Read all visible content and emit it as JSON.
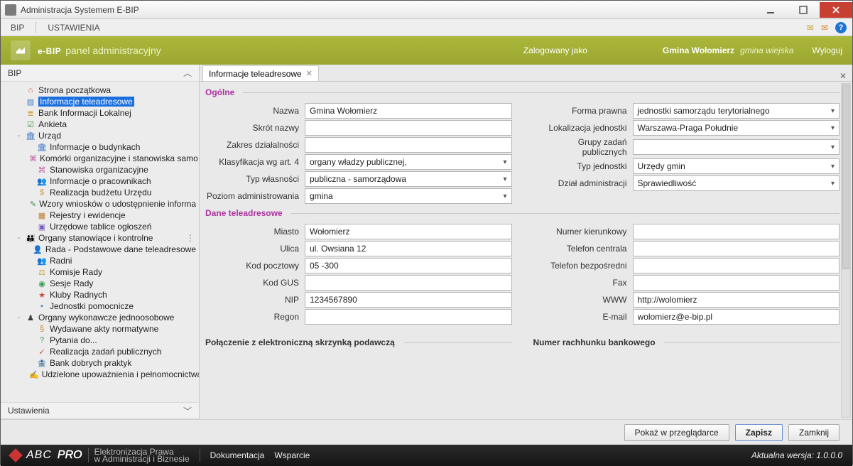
{
  "window": {
    "title": "Administracja Systemem E-BIP"
  },
  "menu": {
    "bip": "BIP",
    "ustawienia": "USTAWIENIA"
  },
  "banner": {
    "brand": "e-BIP",
    "subtitle": "panel administracyjny",
    "logged_as_label": "Zalogowany jako",
    "org_name": "Gmina Wołomierz",
    "org_type": "gmina wiejska",
    "logout": "Wyloguj"
  },
  "sidebar": {
    "header": "BIP",
    "settings_header": "Ustawienia",
    "tree": [
      {
        "label": "Strona początkowa",
        "icon": "ico-home",
        "depth": 1
      },
      {
        "label": "Informacje teleadresowe",
        "icon": "ico-doc",
        "depth": 1,
        "selected": true
      },
      {
        "label": "Bank Informacji Lokalnej",
        "icon": "ico-db",
        "depth": 1
      },
      {
        "label": "Ankieta",
        "icon": "ico-poll",
        "depth": 1
      },
      {
        "label": "Urząd",
        "icon": "ico-bld",
        "depth": 1,
        "expander": "-"
      },
      {
        "label": "Informacje o budynkach",
        "icon": "ico-bld",
        "depth": 2
      },
      {
        "label": "Komórki organizacyjne i stanowiska samo",
        "icon": "ico-org",
        "depth": 2
      },
      {
        "label": "Stanowiska organizacyjne",
        "icon": "ico-org",
        "depth": 2
      },
      {
        "label": "Informacje o pracownikach",
        "icon": "ico-ppl",
        "depth": 2
      },
      {
        "label": "Realizacja budżetu Urzędu",
        "icon": "ico-money",
        "depth": 2
      },
      {
        "label": "Wzory wniosków o udostępnienie informa",
        "icon": "ico-form",
        "depth": 2
      },
      {
        "label": "Rejestry i ewidencje",
        "icon": "ico-reg",
        "depth": 2
      },
      {
        "label": "Urzędowe tablice ogłoszeń",
        "icon": "ico-board",
        "depth": 2
      },
      {
        "label": "Organy stanowiące i kontrolne",
        "icon": "ico-group",
        "depth": 1,
        "expander": "-",
        "dots": true
      },
      {
        "label": "Rada - Podstawowe dane teleadresowe",
        "icon": "ico-person",
        "depth": 2
      },
      {
        "label": "Radni",
        "icon": "ico-ppl",
        "depth": 2
      },
      {
        "label": "Komisje Rady",
        "icon": "ico-komm",
        "depth": 2
      },
      {
        "label": "Sesje Rady",
        "icon": "ico-sesje",
        "depth": 2
      },
      {
        "label": "Kluby Radnych",
        "icon": "ico-klub",
        "depth": 2
      },
      {
        "label": "Jednostki pomocnicze",
        "icon": "ico-unit",
        "depth": 2
      },
      {
        "label": "Organy wykonawcze jednoosobowe",
        "icon": "ico-exec",
        "depth": 1,
        "expander": "-"
      },
      {
        "label": "Wydawane akty normatywne",
        "icon": "ico-act",
        "depth": 2
      },
      {
        "label": "Pytania do...",
        "icon": "ico-q",
        "depth": 2
      },
      {
        "label": "Realizacja zadań publicznych",
        "icon": "ico-task",
        "depth": 2
      },
      {
        "label": "Bank dobrych praktyk",
        "icon": "ico-bank",
        "depth": 2
      },
      {
        "label": "Udzielone upoważnienia i pełnomocnictwa",
        "icon": "ico-auth",
        "depth": 2
      }
    ]
  },
  "tab": {
    "title": "Informacje teleadresowe"
  },
  "sections": {
    "general": "Ogólne",
    "contact": "Dane teleadresowe",
    "mailbox": "Połączenie z elektroniczną skrzynką podawczą",
    "bank": "Numer rachhunku bankowego"
  },
  "general": {
    "left": [
      {
        "label": "Nazwa",
        "type": "text",
        "value": "Gmina Wołomierz"
      },
      {
        "label": "Skrót nazwy",
        "type": "text",
        "value": ""
      },
      {
        "label": "Zakres działalności",
        "type": "text",
        "value": ""
      },
      {
        "label": "Klasyfikacja wg art. 4",
        "type": "select",
        "value": "organy władzy publicznej,"
      },
      {
        "label": "Typ własności",
        "type": "select",
        "value": "publiczna - samorządowa"
      },
      {
        "label": "Poziom administrowania",
        "type": "select",
        "value": "gmina"
      }
    ],
    "right": [
      {
        "label": "Forma prawna",
        "type": "select",
        "value": "jednostki samorządu terytorialnego"
      },
      {
        "label": "Lokalizacja jednostki",
        "type": "select",
        "value": "Warszawa-Praga Południe"
      },
      {
        "label": "Grupy zadań publicznych",
        "type": "select",
        "value": ""
      },
      {
        "label": "Typ jednostki",
        "type": "select",
        "value": "Urzędy gmin"
      },
      {
        "label": "Dział administracji",
        "type": "select",
        "value": "Sprawiedliwość"
      }
    ]
  },
  "contact": {
    "left": [
      {
        "label": "Miasto",
        "type": "text",
        "value": "Wołomierz"
      },
      {
        "label": "Ulica",
        "type": "text",
        "value": "ul. Owsiana 12"
      },
      {
        "label": "Kod pocztowy",
        "type": "text",
        "value": "05 -300"
      },
      {
        "label": "Kod GUS",
        "type": "text",
        "value": ""
      },
      {
        "label": "NIP",
        "type": "text",
        "value": "1234567890"
      },
      {
        "label": "Regon",
        "type": "text",
        "value": ""
      }
    ],
    "right": [
      {
        "label": "Numer kierunkowy",
        "type": "text",
        "value": ""
      },
      {
        "label": "Telefon centrala",
        "type": "text",
        "value": ""
      },
      {
        "label": "Telefon bezpośredni",
        "type": "text",
        "value": ""
      },
      {
        "label": "Fax",
        "type": "text",
        "value": ""
      },
      {
        "label": "WWW",
        "type": "text",
        "value": "http://wolomierz"
      },
      {
        "label": "E-mail",
        "type": "text",
        "value": "wolomierz@e-bip.pl"
      }
    ]
  },
  "buttons": {
    "preview": "Pokaż w przeglądarce",
    "save": "Zapisz",
    "close": "Zamknij"
  },
  "footer": {
    "brand1": "ABC",
    "brand2": "PRO",
    "tag1": "Elektronizacja Prawa",
    "tag2": "w Administracji i Biznesie",
    "doc": "Dokumentacja",
    "support": "Wsparcie",
    "version_label": "Aktualna wersja:",
    "version": "1.0.0.0"
  }
}
